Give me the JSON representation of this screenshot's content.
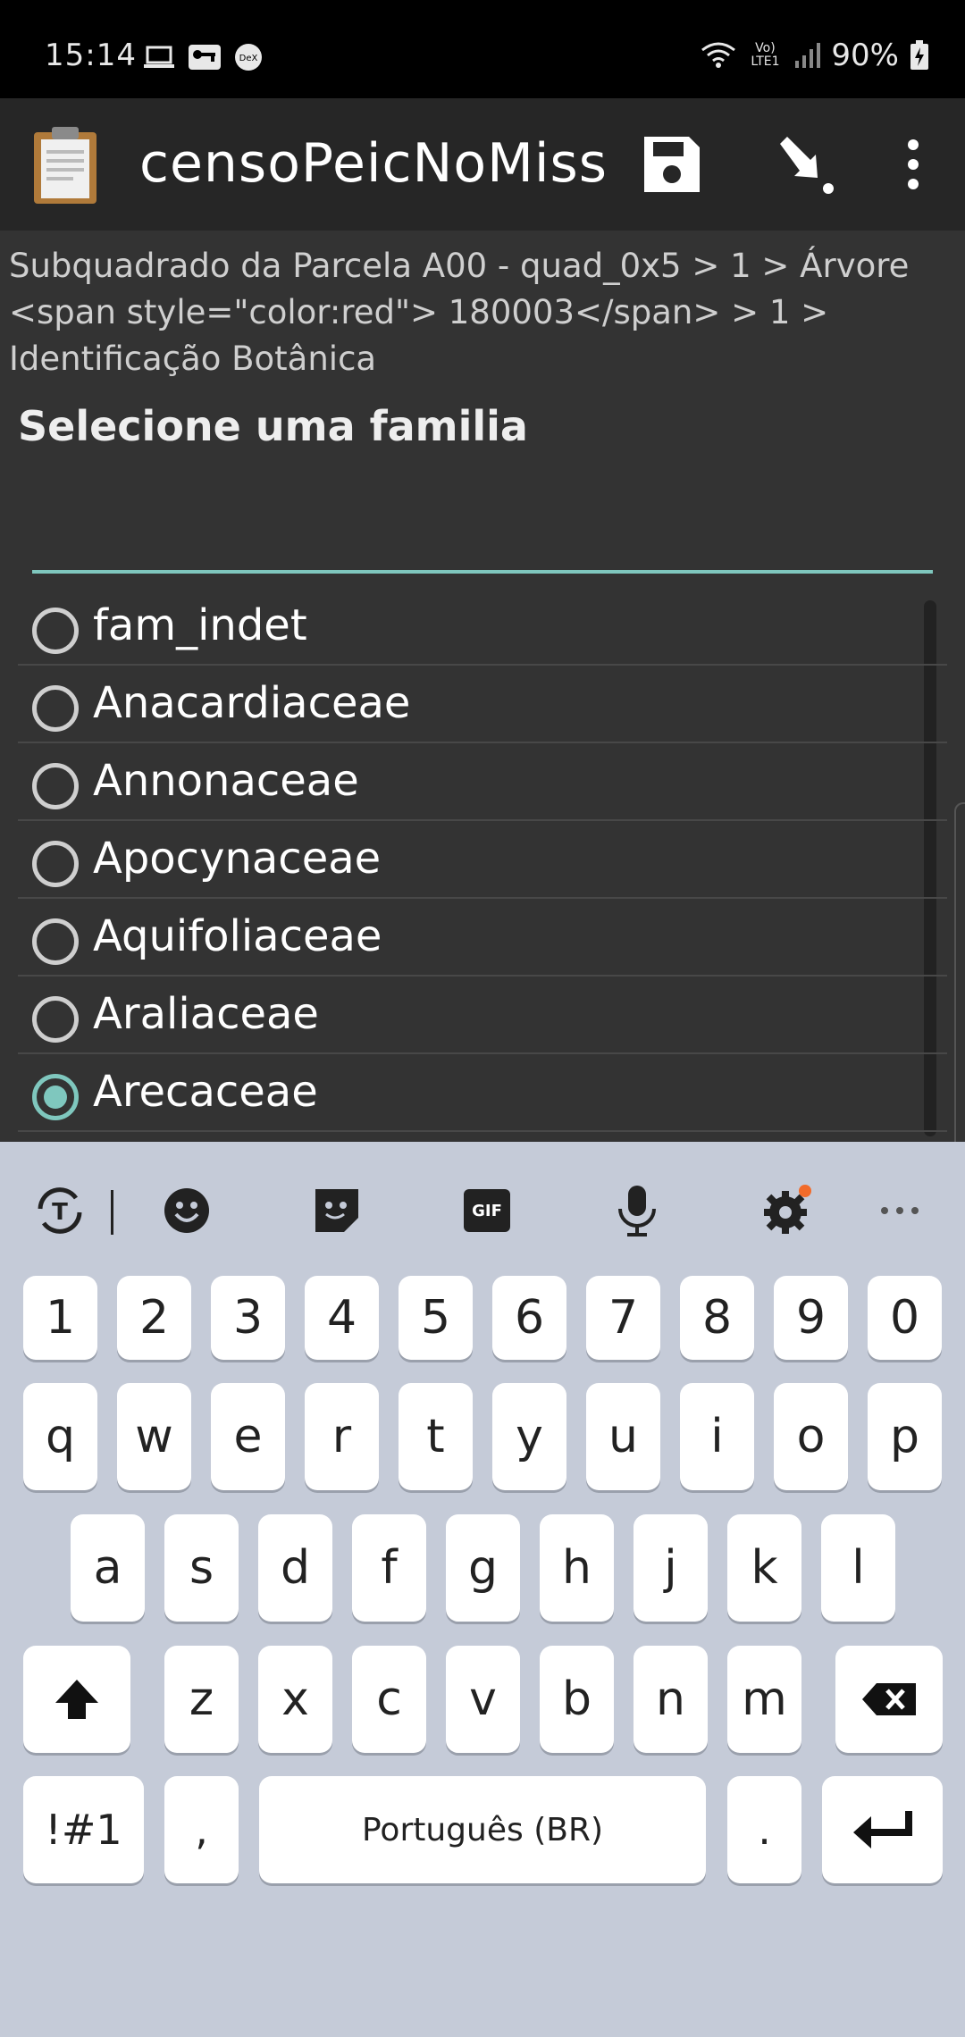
{
  "status_bar": {
    "time": "15:14",
    "network_label": "Vo) LTE1",
    "battery": "90%",
    "icons": [
      "laptop-icon",
      "vpn-key-icon",
      "dex-icon",
      "wifi-icon",
      "signal-icon",
      "battery-charging-icon"
    ]
  },
  "app_bar": {
    "title": "censoPeicNoMiss",
    "icons": [
      "clipboard-icon",
      "save-icon",
      "go-to-icon",
      "more-options-icon"
    ]
  },
  "form": {
    "breadcrumb": "Subquadrado da Parcela A00 - quad_0x5 > 1 > Árvore <span style=\"color:red\"> 180003</span> > 1 > Identificação Botânica",
    "question": "Selecione uma familia",
    "choices": [
      {
        "label": "fam_indet",
        "selected": false
      },
      {
        "label": "Anacardiaceae",
        "selected": false
      },
      {
        "label": "Annonaceae",
        "selected": false
      },
      {
        "label": "Apocynaceae",
        "selected": false
      },
      {
        "label": "Aquifoliaceae",
        "selected": false
      },
      {
        "label": "Araliaceae",
        "selected": false
      },
      {
        "label": "Arecaceae",
        "selected": true
      }
    ],
    "accent_color": "#7fc7be"
  },
  "keyboard": {
    "toolbar_icons": [
      "translate-icon",
      "emoji-icon",
      "sticker-icon",
      "gif-icon",
      "microphone-icon",
      "settings-icon",
      "more-icon"
    ],
    "gif_label": "GIF",
    "row_numbers": [
      "1",
      "2",
      "3",
      "4",
      "5",
      "6",
      "7",
      "8",
      "9",
      "0"
    ],
    "row_q": [
      "q",
      "w",
      "e",
      "r",
      "t",
      "y",
      "u",
      "i",
      "o",
      "p"
    ],
    "row_a": [
      "a",
      "s",
      "d",
      "f",
      "g",
      "h",
      "j",
      "k",
      "l"
    ],
    "row_z": [
      "z",
      "x",
      "c",
      "v",
      "b",
      "n",
      "m"
    ],
    "symbols_label": "!#1",
    "comma_label": ",",
    "space_label": "Português (BR)",
    "period_label": "."
  }
}
